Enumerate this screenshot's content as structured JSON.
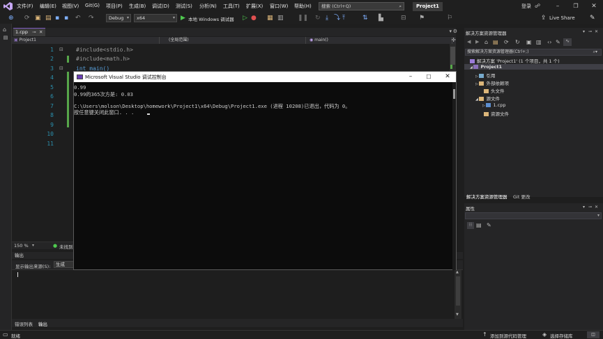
{
  "menubar": {
    "items": [
      "文件(F)",
      "编辑(E)",
      "视图(V)",
      "Git(G)",
      "项目(P)",
      "生成(B)",
      "调试(D)",
      "测试(S)",
      "分析(N)",
      "工具(T)",
      "扩展(X)",
      "窗口(W)",
      "帮助(H)"
    ],
    "search_placeholder": "搜索 (Ctrl+Q)",
    "project_badge": "Project1",
    "login": "登录"
  },
  "toolbar": {
    "config": "Debug",
    "platform": "x64",
    "run_label": "本地 Windows 调试器",
    "live_share": "Live Share"
  },
  "editor": {
    "tab_label": "1.cpp",
    "nav_project": "Project1",
    "nav_scope": "(全局范围)",
    "nav_function": "main()",
    "line_numbers": [
      "1",
      "2",
      "3",
      "4",
      "5",
      "6",
      "7",
      "8",
      "9",
      "10",
      "11"
    ],
    "code_lines": [
      "#include<stdio.h>",
      "#include<math.h>",
      "int main()",
      "{",
      "",
      "",
      "",
      "",
      "",
      "",
      "}"
    ],
    "zoom": "150 %",
    "status_text": "未找到"
  },
  "output": {
    "title": "输出",
    "source_label": "显示输出来源(S):",
    "source_value": "生成",
    "tabs": [
      "错误列表",
      "输出"
    ]
  },
  "console": {
    "title": "Microsoft Visual Studio 调试控制台",
    "lines": [
      "0.99",
      "0.99的365次方是: 0.03",
      "",
      "C:\\Users\\molson\\Desktop\\homework\\Project1\\x64\\Debug\\Project1.exe (进程 10208)已退出，代码为 0。",
      "按任意键关闭此窗口. . ."
    ]
  },
  "solution_explorer": {
    "title": "解决方案资源管理器",
    "search_placeholder": "搜索解决方案资源管理器(Ctrl+;)",
    "solution_label": "解决方案 'Project1' (1 个项目，共 1 个)",
    "project": "Project1",
    "nodes": [
      "引用",
      "外部依赖项",
      "头文件",
      "源文件",
      "1.cpp",
      "资源文件"
    ],
    "tabs": [
      "解决方案资源管理器",
      "Git 更改"
    ]
  },
  "properties": {
    "title": "属性"
  },
  "statusbar": {
    "ready": "就绪",
    "source_control": "添加到源代码管理",
    "repo": "选择存储库"
  },
  "colors": {
    "accent": "#7c5bbf",
    "console_bg": "#0c0c0c",
    "line_number": "#2b91af",
    "change_bar": "#57a64a"
  }
}
